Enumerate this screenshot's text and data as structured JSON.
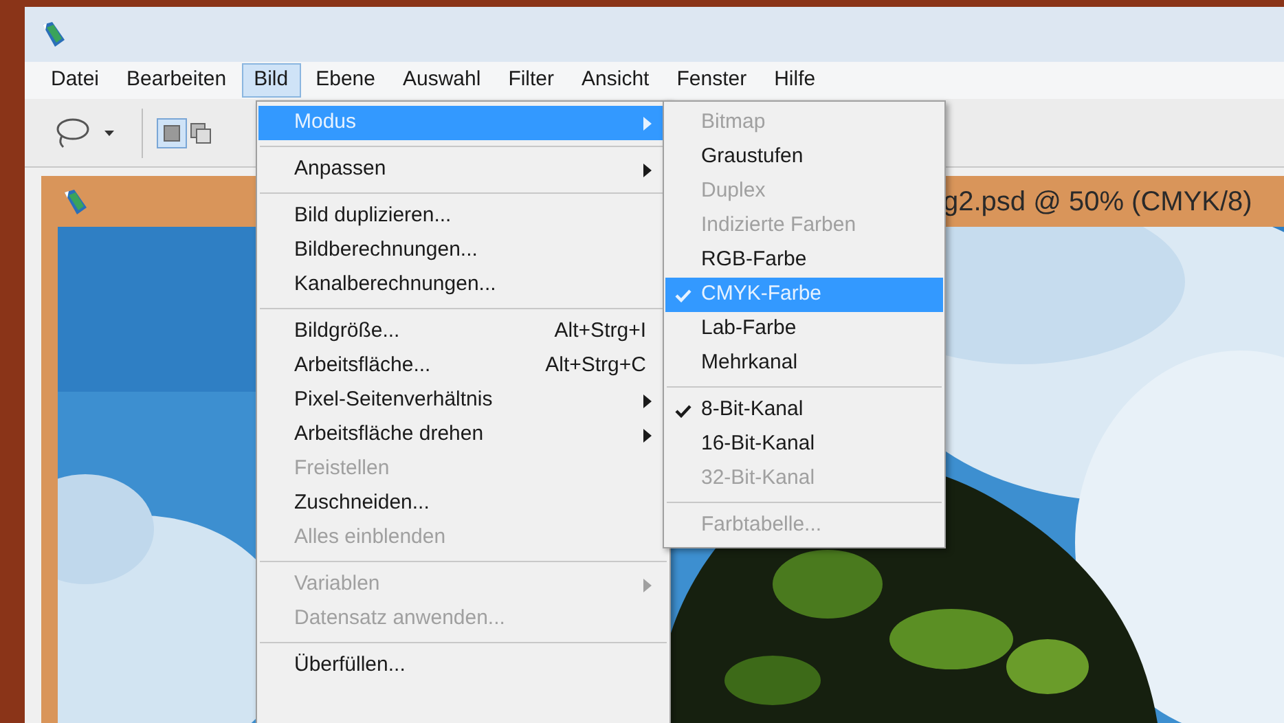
{
  "menubar": [
    {
      "label": "Datei",
      "selected": false
    },
    {
      "label": "Bearbeiten",
      "selected": false
    },
    {
      "label": "Bild",
      "selected": true
    },
    {
      "label": "Ebene",
      "selected": false
    },
    {
      "label": "Auswahl",
      "selected": false
    },
    {
      "label": "Filter",
      "selected": false
    },
    {
      "label": "Ansicht",
      "selected": false
    },
    {
      "label": "Fenster",
      "selected": false
    },
    {
      "label": "Hilfe",
      "selected": false
    }
  ],
  "document": {
    "title": "g2.psd @ 50% (CMYK/8)"
  },
  "bild_menu": [
    {
      "kind": "item",
      "label": "Modus",
      "selected": true,
      "disabled": false,
      "submenu": true
    },
    {
      "kind": "separator"
    },
    {
      "kind": "item",
      "label": "Anpassen",
      "selected": false,
      "disabled": false,
      "submenu": true
    },
    {
      "kind": "separator"
    },
    {
      "kind": "item",
      "label": "Bild duplizieren...",
      "selected": false,
      "disabled": false,
      "submenu": false
    },
    {
      "kind": "item",
      "label": "Bildberechnungen...",
      "selected": false,
      "disabled": false,
      "submenu": false
    },
    {
      "kind": "item",
      "label": "Kanalberechnungen...",
      "selected": false,
      "disabled": false,
      "submenu": false
    },
    {
      "kind": "separator"
    },
    {
      "kind": "item",
      "label": "Bildgröße...",
      "shortcut": "Alt+Strg+I",
      "selected": false,
      "disabled": false,
      "submenu": false
    },
    {
      "kind": "item",
      "label": "Arbeitsfläche...",
      "shortcut": "Alt+Strg+C",
      "selected": false,
      "disabled": false,
      "submenu": false
    },
    {
      "kind": "item",
      "label": "Pixel-Seitenverhältnis",
      "selected": false,
      "disabled": false,
      "submenu": true
    },
    {
      "kind": "item",
      "label": "Arbeitsfläche drehen",
      "selected": false,
      "disabled": false,
      "submenu": true
    },
    {
      "kind": "item",
      "label": "Freistellen",
      "selected": false,
      "disabled": true,
      "submenu": false
    },
    {
      "kind": "item",
      "label": "Zuschneiden...",
      "selected": false,
      "disabled": false,
      "submenu": false
    },
    {
      "kind": "item",
      "label": "Alles einblenden",
      "selected": false,
      "disabled": true,
      "submenu": false
    },
    {
      "kind": "separator"
    },
    {
      "kind": "item",
      "label": "Variablen",
      "selected": false,
      "disabled": true,
      "submenu": true
    },
    {
      "kind": "item",
      "label": "Datensatz anwenden...",
      "selected": false,
      "disabled": true,
      "submenu": false
    },
    {
      "kind": "separator"
    },
    {
      "kind": "item",
      "label": "Überfüllen...",
      "selected": false,
      "disabled": false,
      "submenu": false
    }
  ],
  "modus_menu": [
    {
      "kind": "item",
      "label": "Bitmap",
      "checked": false,
      "selected": false,
      "disabled": true
    },
    {
      "kind": "item",
      "label": "Graustufen",
      "checked": false,
      "selected": false,
      "disabled": false
    },
    {
      "kind": "item",
      "label": "Duplex",
      "checked": false,
      "selected": false,
      "disabled": true
    },
    {
      "kind": "item",
      "label": "Indizierte Farben",
      "checked": false,
      "selected": false,
      "disabled": true
    },
    {
      "kind": "item",
      "label": "RGB-Farbe",
      "checked": false,
      "selected": false,
      "disabled": false
    },
    {
      "kind": "item",
      "label": "CMYK-Farbe",
      "checked": true,
      "selected": true,
      "disabled": false
    },
    {
      "kind": "item",
      "label": "Lab-Farbe",
      "checked": false,
      "selected": false,
      "disabled": false
    },
    {
      "kind": "item",
      "label": "Mehrkanal",
      "checked": false,
      "selected": false,
      "disabled": false
    },
    {
      "kind": "separator"
    },
    {
      "kind": "item",
      "label": "8-Bit-Kanal",
      "checked": true,
      "selected": false,
      "disabled": false
    },
    {
      "kind": "item",
      "label": "16-Bit-Kanal",
      "checked": false,
      "selected": false,
      "disabled": false
    },
    {
      "kind": "item",
      "label": "32-Bit-Kanal",
      "checked": false,
      "selected": false,
      "disabled": true
    },
    {
      "kind": "separator"
    },
    {
      "kind": "item",
      "label": "Farbtabelle...",
      "checked": false,
      "selected": false,
      "disabled": true
    }
  ]
}
